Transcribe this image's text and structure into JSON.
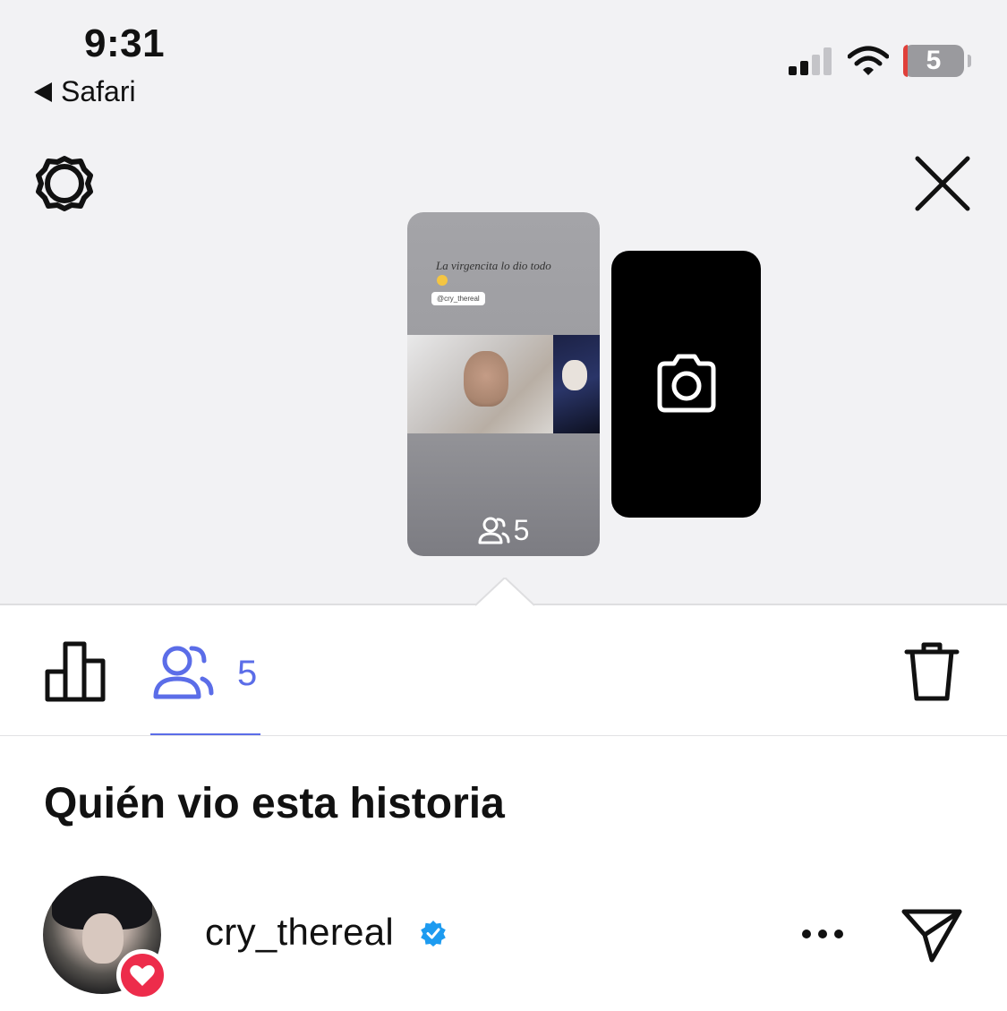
{
  "status_bar": {
    "time": "9:31",
    "back_label": "Safari",
    "battery_level": "5",
    "signal_bars_active": 2,
    "signal_bars_total": 4
  },
  "top_bar": {
    "settings_icon": "gear-icon",
    "close_icon": "close-icon"
  },
  "story": {
    "caption": "La virgencita lo dio todo",
    "mention": "@cry_thereal",
    "viewer_count": "5",
    "viewers_icon": "viewers-icon"
  },
  "camera_card": {
    "icon": "camera-icon"
  },
  "tabs": {
    "insights_icon": "bar-chart-icon",
    "viewers_icon": "viewers-icon",
    "viewer_count": "5",
    "delete_icon": "trash-icon",
    "active_color": "#5b6de8"
  },
  "section_title": "Quién vio esta historia",
  "viewers": [
    {
      "username": "cry_thereal",
      "verified": true,
      "reacted": "heart",
      "more_icon": "more-icon",
      "send_icon": "send-icon"
    }
  ],
  "colors": {
    "accent": "#5b6de8",
    "heart": "#ed2c4b",
    "verified": "#1d9bf0",
    "background_top": "#f2f2f4"
  }
}
